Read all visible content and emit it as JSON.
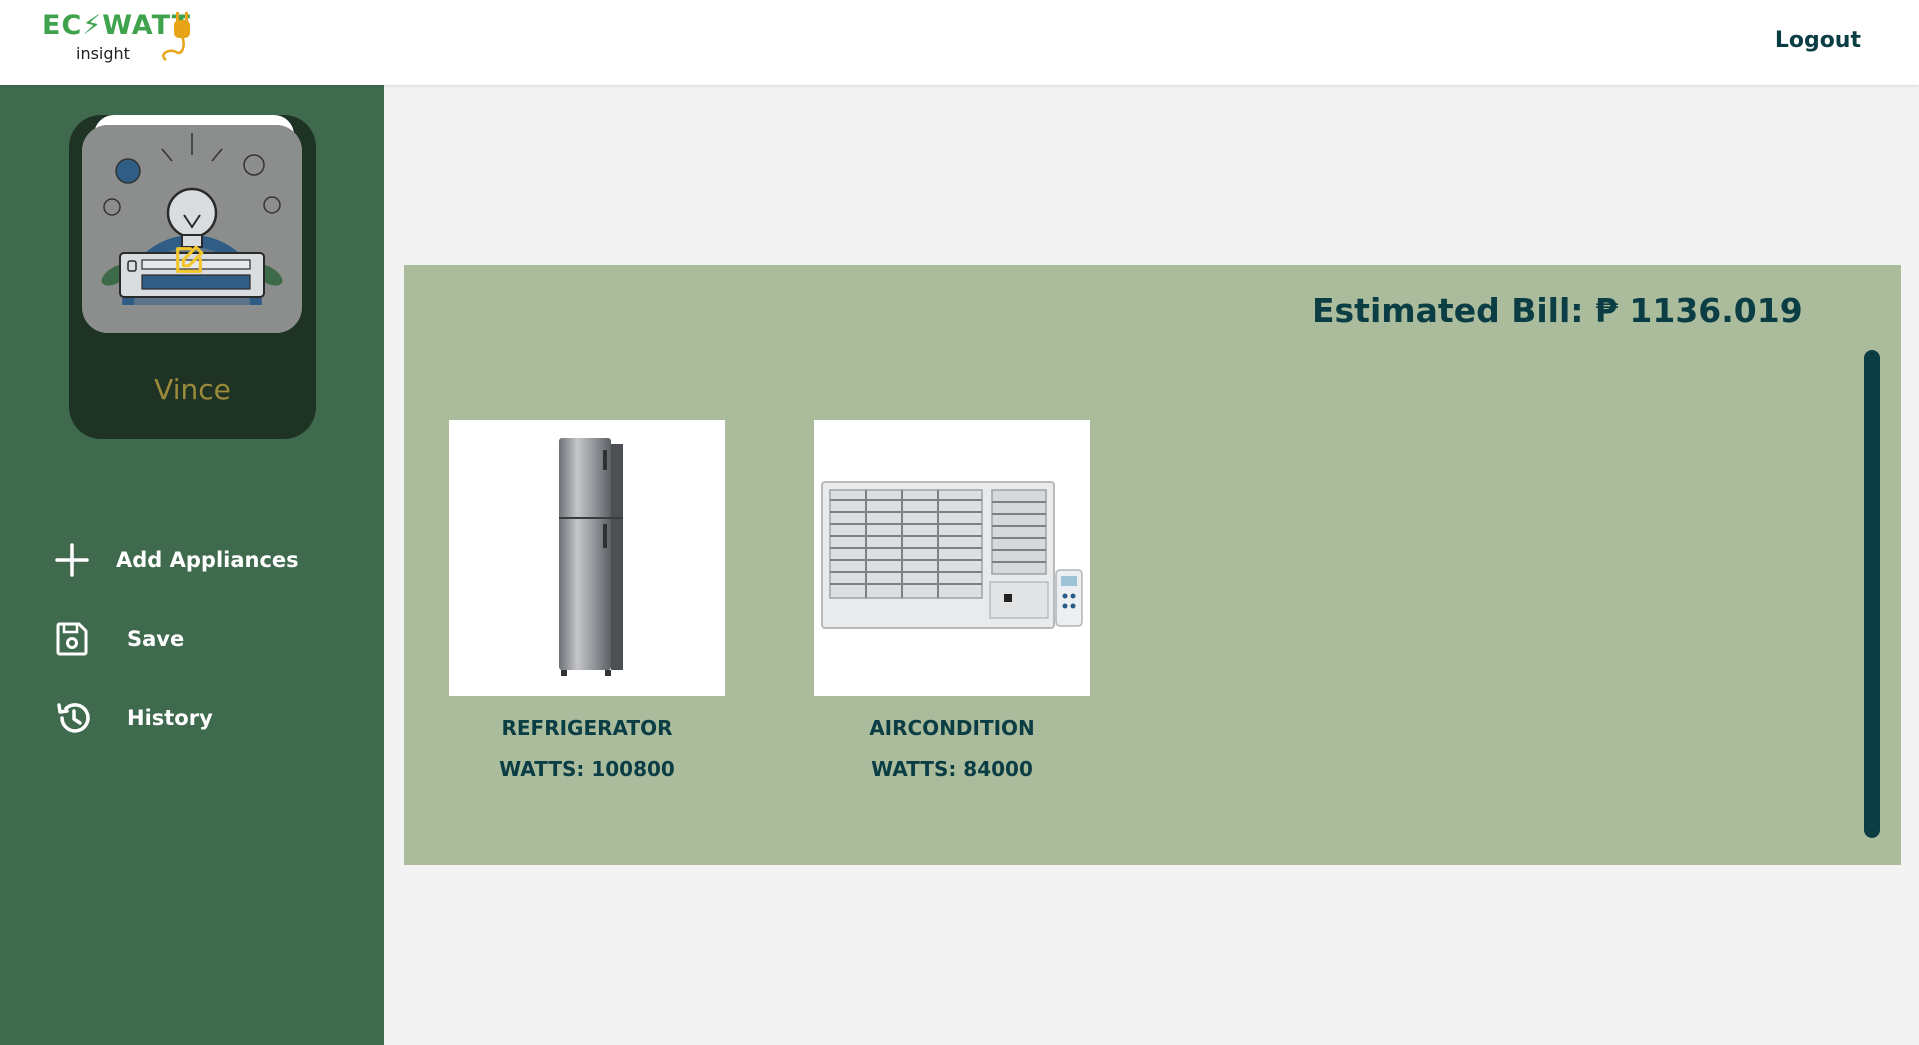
{
  "header": {
    "logo_top": "EC⚡WATT",
    "logo_bottom": "insight",
    "logout_label": "Logout"
  },
  "sidebar": {
    "user_name": "Vince",
    "items": [
      {
        "label": "Add Appliances",
        "icon": "plus-icon"
      },
      {
        "label": "Save",
        "icon": "floppy-disk-icon"
      },
      {
        "label": "History",
        "icon": "history-icon"
      }
    ]
  },
  "main": {
    "bill_text": "Estimated Bill: ₱ 1136.019",
    "appliances": [
      {
        "name": "REFRIGERATOR",
        "watts": "WATTS: 100800",
        "icon": "refrigerator-image"
      },
      {
        "name": "AIRCONDITION",
        "watts": "WATTS: 84000",
        "icon": "air-conditioner-image"
      }
    ]
  },
  "colors": {
    "sidebar": "#3f6a4d",
    "panel": "#abbc9c",
    "accent": "#0b3d45",
    "profile_card": "#1f3325"
  }
}
